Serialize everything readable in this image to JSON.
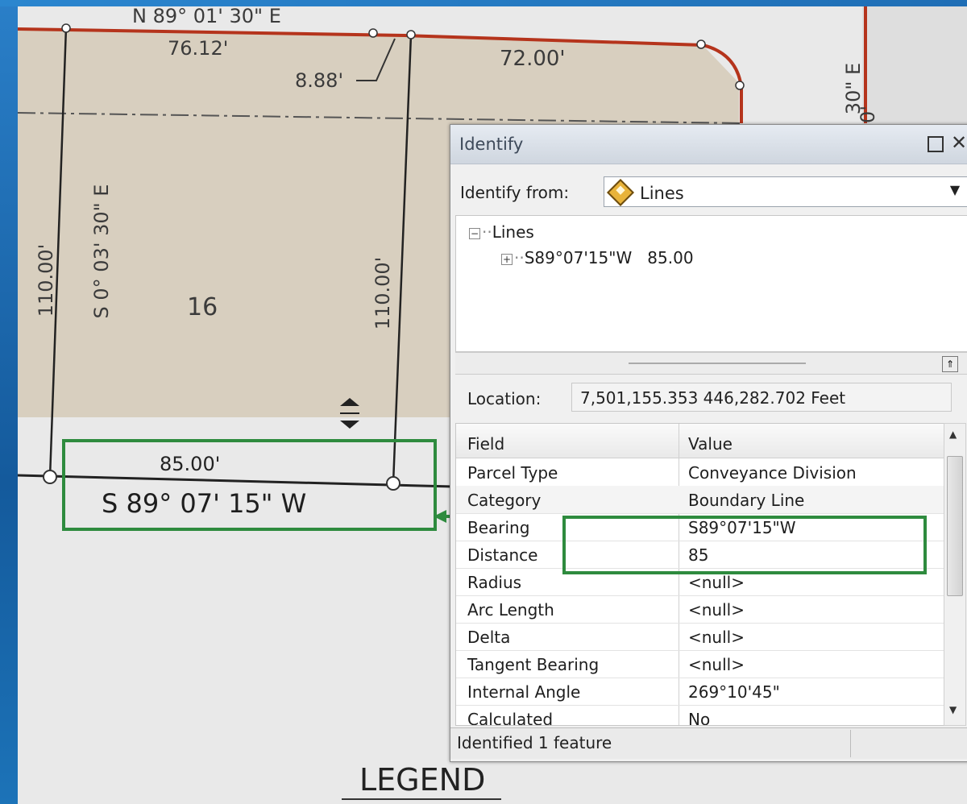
{
  "map": {
    "labels": {
      "bearing_top": "N 89° 01' 30\" E",
      "dist_76": "76.12'",
      "dist_72": "72.00'",
      "dist_888": "8.88'",
      "dist_110_left": "110.00'",
      "bearing_left": "S 0° 03' 30\" E",
      "dist_110_right": "110.00'",
      "lot": "16",
      "bearing_right_partial": "30\" E",
      "bearing_right_partial2": "0'",
      "dist_85": "85.00'",
      "bearing_bottom": "S 89° 07' 15\" W",
      "legend": "LEGEND"
    }
  },
  "identify": {
    "title": "Identify",
    "identify_from_label": "Identify from:",
    "identify_from_value": "Lines",
    "tree": {
      "root": "Lines",
      "child": "S89°07'15\"W   85.00"
    },
    "location_label": "Location:",
    "location_value": "7,501,155.353  446,282.702 Feet",
    "columns": [
      "Field",
      "Value"
    ],
    "rows": [
      {
        "field": "Parcel Type",
        "value": "Conveyance Division"
      },
      {
        "field": "Category",
        "value": "Boundary Line"
      },
      {
        "field": "Bearing",
        "value": "S89°07'15\"W"
      },
      {
        "field": "Distance",
        "value": "85"
      },
      {
        "field": "Radius",
        "value": "<null>"
      },
      {
        "field": "Arc Length",
        "value": "<null>"
      },
      {
        "field": "Delta",
        "value": "<null>"
      },
      {
        "field": "Tangent Bearing",
        "value": "<null>"
      },
      {
        "field": "Internal Angle",
        "value": "269°10'45\""
      },
      {
        "field": "Calculated",
        "value": "No"
      }
    ],
    "status": "Identified 1 feature"
  },
  "colors": {
    "parcel_fill": "#d8cfbf",
    "boundary_red": "#b5341c",
    "highlight_green": "#2e8b3e"
  }
}
